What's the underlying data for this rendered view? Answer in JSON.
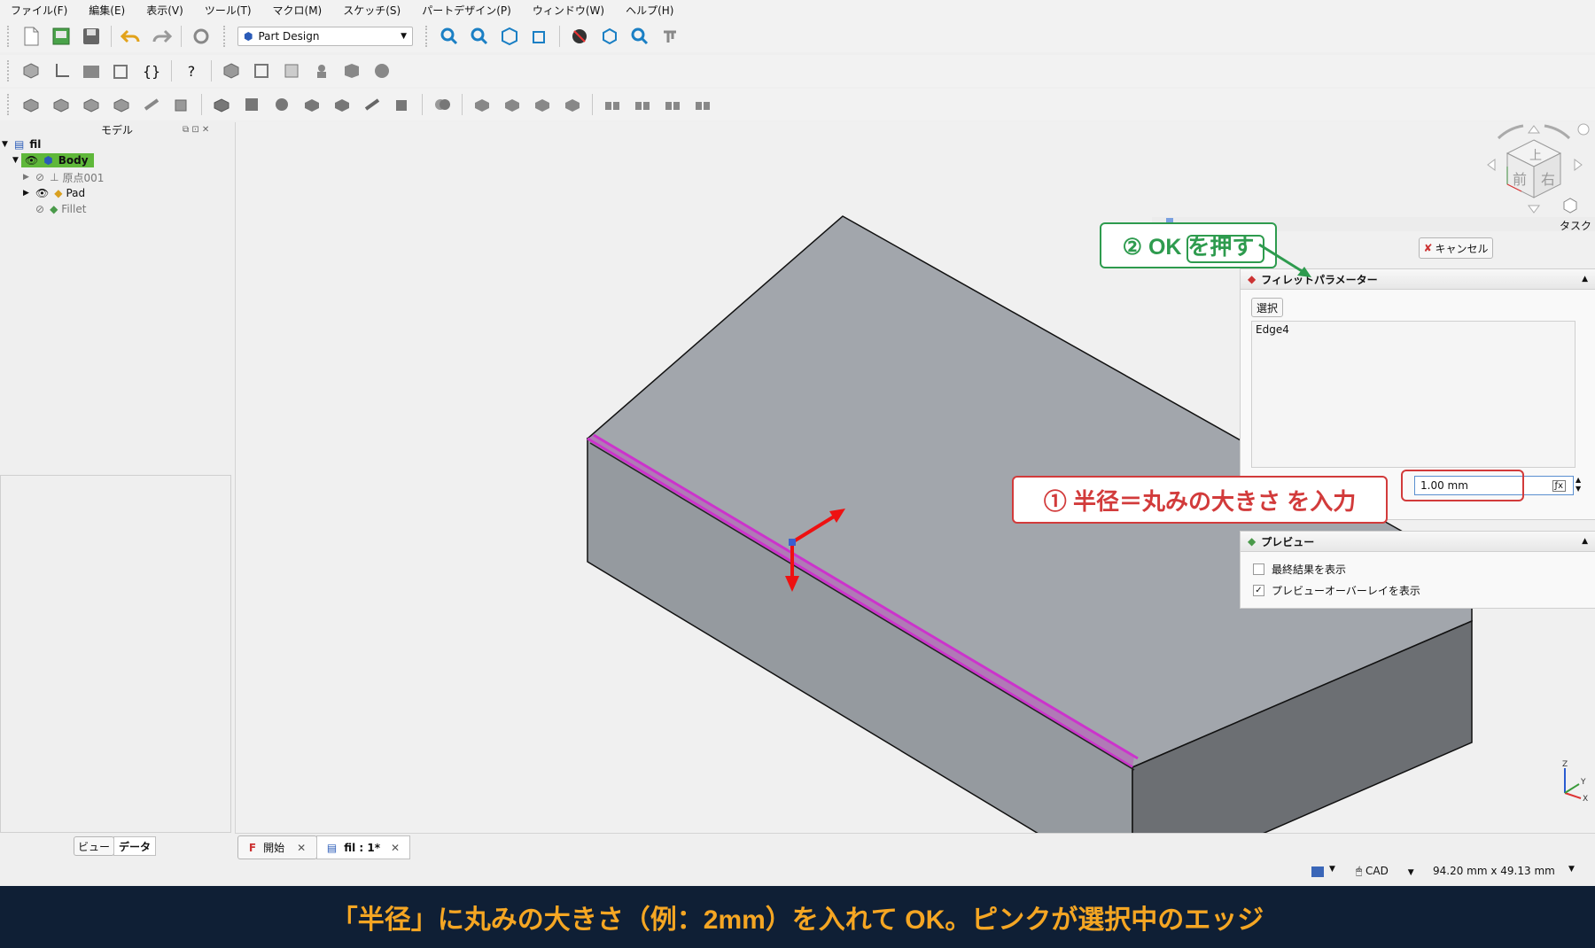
{
  "menu": [
    "ファイル(F)",
    "編集(E)",
    "表示(V)",
    "ツール(T)",
    "マクロ(M)",
    "スケッチ(S)",
    "パートデザイン(P)",
    "ウィンドウ(W)",
    "ヘルプ(H)"
  ],
  "toolbar": {
    "workbench": "Part Design"
  },
  "tree": {
    "header": "モデル",
    "document": "fil",
    "body": "Body",
    "origin": "原点001",
    "pad": "Pad",
    "fillet": "Fillet"
  },
  "panel_tabs": {
    "view": "ビュー",
    "data": "データ"
  },
  "doc_tabs": {
    "start": "開始",
    "active": "fil : 1*"
  },
  "navcube": {
    "top": "上",
    "front": "前",
    "right": "右"
  },
  "task": {
    "title": "タスク",
    "ok_label": "OK",
    "cancel_label": "キャンセル",
    "fillet_section": "フィレットパラメーター",
    "select_button": "選択",
    "edge_list": [
      "Edge4"
    ],
    "radius_value": "1.00 mm",
    "preview_section": "プレビュー",
    "preview_final_label": "最終結果を表示",
    "preview_final_checked": false,
    "preview_overlay_label": "プレビューオーバーレイを表示",
    "preview_overlay_checked": true
  },
  "annotations": {
    "ok_callout": "② OK を押す",
    "radius_callout": "① 半径＝丸みの大きさ を入力",
    "ok_color": "#2e9b4e",
    "radius_color": "#d23b3b"
  },
  "status": {
    "nav_style": "CAD",
    "dimensions": "94.20 mm x 49.13 mm"
  },
  "caption": {
    "text": "「半径」に丸みの大きさ（例：2mm）を入れて OK。ピンクが選択中のエッジ",
    "color": "#f5a623",
    "background": "#0f1f35"
  },
  "colors": {
    "selection": "#cc33cc",
    "body_highlight": "#5fb83a"
  }
}
